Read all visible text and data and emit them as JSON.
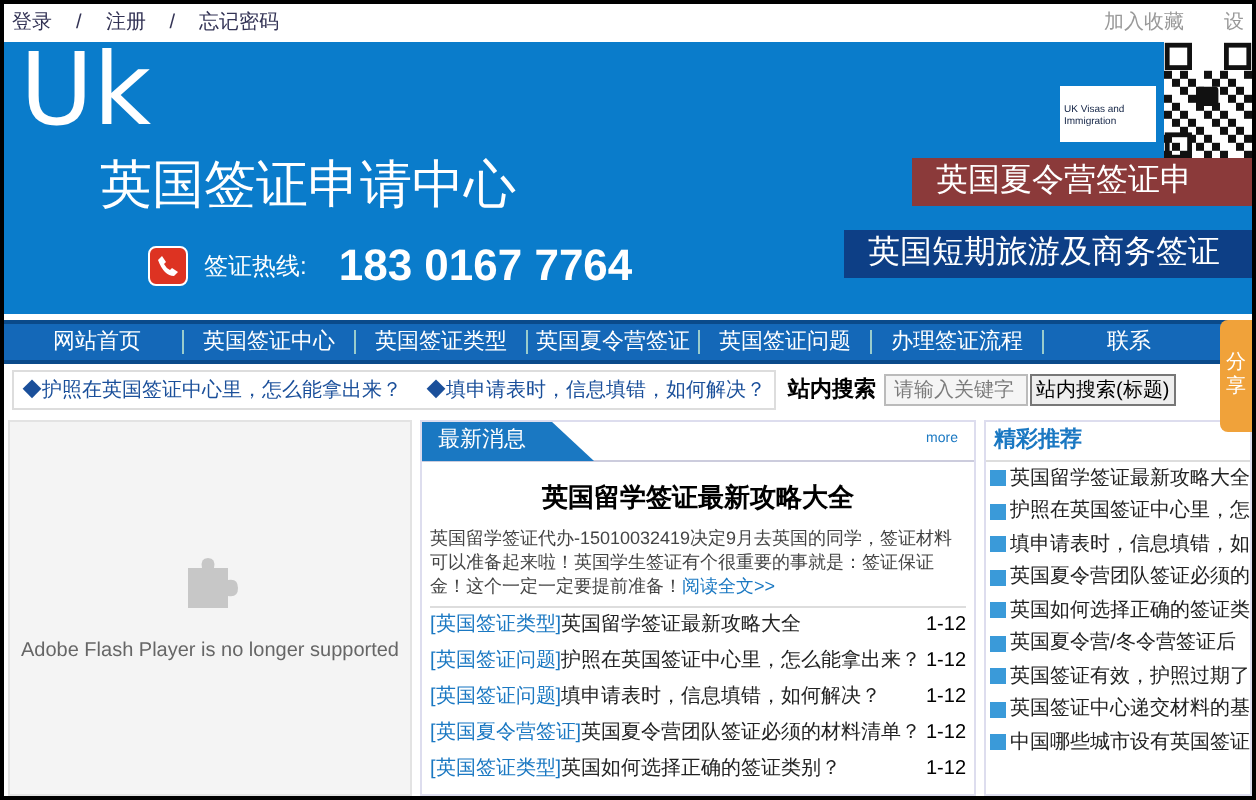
{
  "top_bar": {
    "links": [
      "登录",
      "注册",
      "忘记密码"
    ],
    "separator": "/",
    "right_links": [
      "加入收藏",
      "设"
    ]
  },
  "banner": {
    "logo": "Uk",
    "title": "英国签证申请中心",
    "hotline_label": "签证热线:",
    "hotline": "183 0167 7764",
    "badge": "UK Visas and Immigration",
    "ribbons": [
      {
        "text": "英国夏令营签证申",
        "color": "#8b3a3a"
      },
      {
        "text": "英国短期旅游及商务签证",
        "color": "#0d3f86"
      }
    ]
  },
  "nav": [
    "网站首页",
    "英国签证中心",
    "英国签证类型",
    "英国夏令营签证",
    "英国签证问题",
    "办理签证流程",
    "联系"
  ],
  "share_tab": "分享",
  "notices": [
    "◆护照在英国签证中心里，怎么能拿出来？",
    "◆填申请表时，信息填错，如何解决？"
  ],
  "search": {
    "label": "站内搜索",
    "placeholder": "请输入关键字",
    "button": "站内搜索(标题)"
  },
  "flash": {
    "message": "Adobe Flash Player is no longer supported"
  },
  "news": {
    "tab": "最新消息",
    "more": "more",
    "headline": "英国留学签证最新攻略大全",
    "summary": "英国留学签证代办-15010032419决定9月去英国的同学，签证材料可以准备起来啦！英国学生签证有个很重要的事就是：签证保证金！这个一定一定要提前准备！",
    "read_more": "阅读全文>>",
    "items": [
      {
        "category": "[英国签证类型]",
        "title": "英国留学签证最新攻略大全",
        "date": "1-12"
      },
      {
        "category": "[英国签证问题]",
        "title": "护照在英国签证中心里，怎么能拿出来？",
        "date": "1-12"
      },
      {
        "category": "[英国签证问题]",
        "title": "填申请表时，信息填错，如何解决？",
        "date": "1-12"
      },
      {
        "category": "[英国夏令营签证]",
        "title": "英国夏令营团队签证必须的材料清单？",
        "date": "1-12"
      },
      {
        "category": "[英国签证类型]",
        "title": "英国如何选择正确的签证类别？",
        "date": "1-12"
      }
    ]
  },
  "recommend": {
    "title": "精彩推荐",
    "items": [
      "英国留学签证最新攻略大全",
      "护照在英国签证中心里，怎",
      "填申请表时，信息填错，如",
      "英国夏令营团队签证必须的",
      "英国如何选择正确的签证类",
      "英国夏令营/冬令营签证后",
      "英国签证有效，护照过期了",
      "英国签证中心递交材料的基",
      "中国哪些城市设有英国签证"
    ]
  }
}
